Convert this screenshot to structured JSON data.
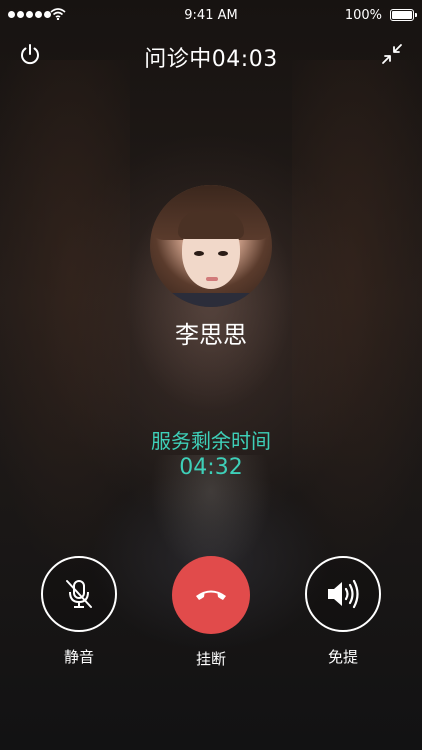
{
  "status_bar": {
    "time": "9:41 AM",
    "battery": "100%",
    "signal_icon": "signal-dots-icon",
    "wifi_icon": "wifi-icon",
    "battery_icon": "battery-full-icon"
  },
  "header": {
    "title": "问诊中04:03",
    "left_icon": "power-icon",
    "right_icon": "minimize-icon"
  },
  "caller": {
    "name": "李思思"
  },
  "service": {
    "label": "服务剩余时间",
    "remaining": "04:32"
  },
  "controls": [
    {
      "label": "静音",
      "icon": "microphone-muted-icon"
    },
    {
      "label": "挂断",
      "icon": "phone-hangup-icon"
    },
    {
      "label": "免提",
      "icon": "speaker-icon"
    }
  ],
  "colors": {
    "accent": "#3ed0b9",
    "hangup": "#e14b4b",
    "text": "#ffffff"
  }
}
